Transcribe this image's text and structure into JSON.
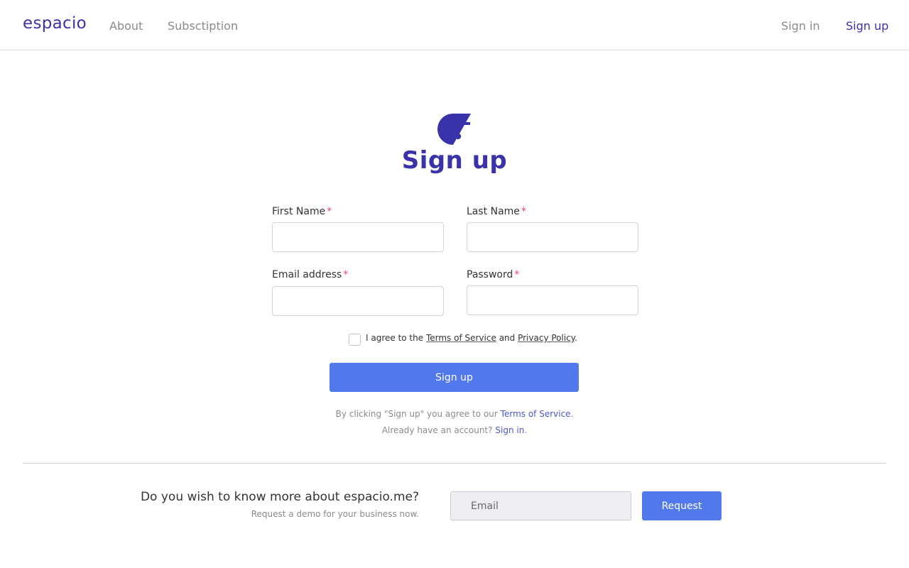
{
  "header": {
    "logo_text": "espacio",
    "nav": {
      "about": "About",
      "subscription": "Subsctiption"
    },
    "auth": {
      "sign_in": "Sign in",
      "sign_up": "Sign up"
    }
  },
  "signup": {
    "title": "Sign up",
    "required_mark": "*",
    "fields": {
      "first_name": {
        "label": "First Name",
        "value": ""
      },
      "last_name": {
        "label": "Last Name",
        "value": ""
      },
      "email": {
        "label": "Email address",
        "value": ""
      },
      "password": {
        "label": "Password",
        "value": ""
      }
    },
    "agree": {
      "checked": false,
      "prefix": "I agree to the",
      "terms_link": "Terms of Service",
      "and": "and",
      "privacy_link": "Privacy Policy",
      "suffix": "."
    },
    "submit_label": "Sign up",
    "terms_note": {
      "prefix": "By clicking \"Sign up\" you agree to our",
      "link": "Terms of Service",
      "suffix": "."
    },
    "signin_note": {
      "prefix": "Already have an account?",
      "link": "Sign in",
      "suffix": "."
    }
  },
  "cta": {
    "title": "Do you wish to know more about espacio.me?",
    "subtitle": "Request a demo for your business now.",
    "email_placeholder": "Email",
    "email_value": "",
    "button_label": "Request"
  },
  "colors": {
    "brand": "#3a32a8",
    "primary_button": "#5179eb",
    "required": "#e2426a",
    "link": "#4b57c8"
  }
}
